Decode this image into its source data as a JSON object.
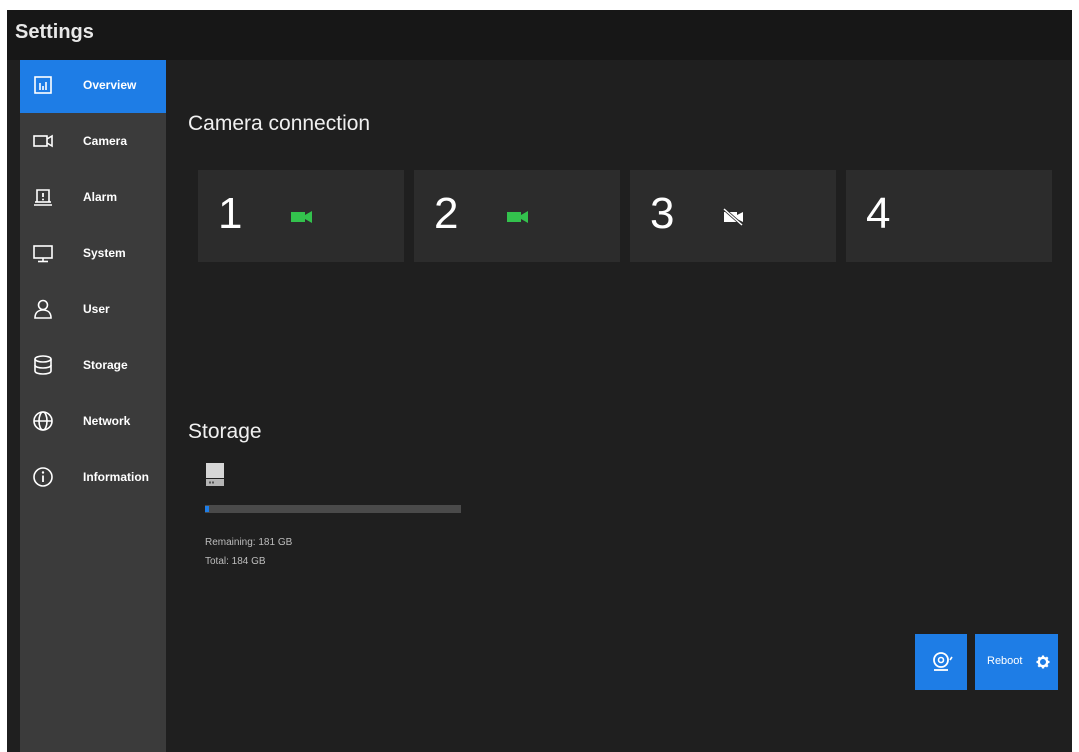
{
  "window": {
    "title": "Settings"
  },
  "sidebar": {
    "items": [
      {
        "label": "Overview",
        "icon": "bar-chart-icon",
        "active": true
      },
      {
        "label": "Camera",
        "icon": "video-camera-icon"
      },
      {
        "label": "Alarm",
        "icon": "alarm-icon"
      },
      {
        "label": "System",
        "icon": "monitor-icon"
      },
      {
        "label": "User",
        "icon": "user-icon"
      },
      {
        "label": "Storage",
        "icon": "database-icon"
      },
      {
        "label": "Network",
        "icon": "globe-icon"
      },
      {
        "label": "Information",
        "icon": "info-icon"
      }
    ]
  },
  "camera_connection": {
    "title": "Camera connection",
    "cameras": [
      {
        "number": "1",
        "status": "connected",
        "icon": "camera-connected-icon"
      },
      {
        "number": "2",
        "status": "connected",
        "icon": "camera-connected-icon"
      },
      {
        "number": "3",
        "status": "disconnected",
        "icon": "camera-off-icon"
      },
      {
        "number": "4",
        "status": "none",
        "icon": ""
      }
    ]
  },
  "storage": {
    "title": "Storage",
    "used_fraction": 0.016,
    "remaining": "Remaining: 181 GB",
    "total": "Total: 184 GB"
  },
  "actions": {
    "reboot_label": "Reboot"
  },
  "colors": {
    "accent": "#1e7de6",
    "connected": "#33c24d",
    "background": "#1f1f1f",
    "sidebar": "#3b3b3b",
    "card": "#2c2c2c"
  }
}
